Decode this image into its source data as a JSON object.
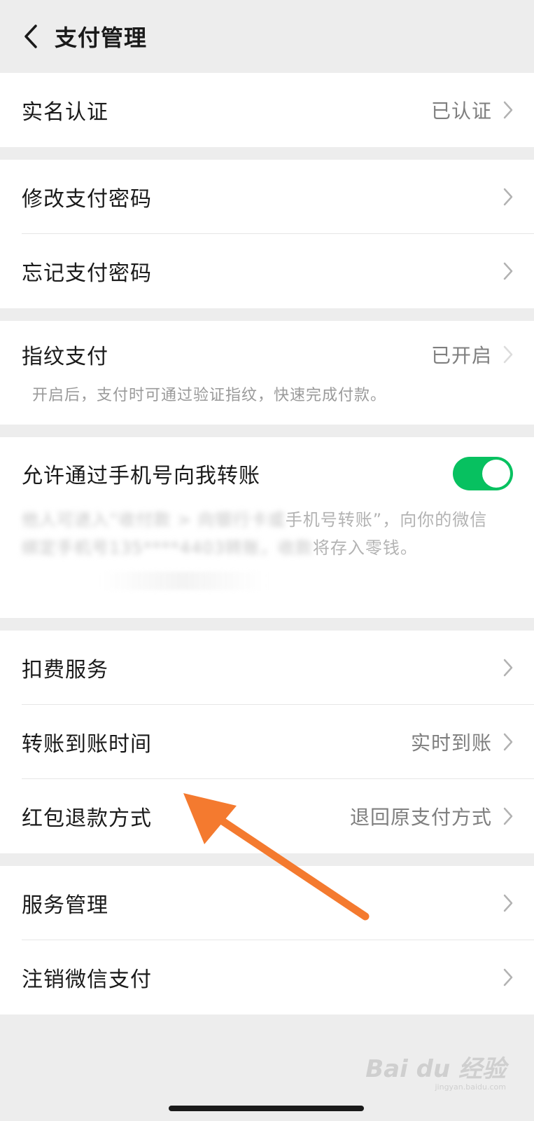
{
  "header": {
    "title": "支付管理",
    "back_icon": "chevron-left-icon"
  },
  "groups": {
    "verify": {
      "label": "实名认证",
      "value": "已认证"
    },
    "password": {
      "change_label": "修改支付密码",
      "forgot_label": "忘记支付密码"
    },
    "fingerprint": {
      "label": "指纹支付",
      "value": "已开启",
      "desc": "开启后，支付时可通过验证指纹，快速完成付款。"
    },
    "phone_transfer": {
      "label": "允许通过手机号向我转账",
      "toggle_on": true,
      "toggle_color": "#07c160",
      "desc_line1_blurred": "他人可进入“收付款 > 向银行卡或",
      "desc_line1_clear": "手机号转账”，向你的微信",
      "desc_line2_blurred": "绑定手机号135****4403转账，收款",
      "desc_line2_clear": "将存入零钱。"
    },
    "services": {
      "deduction_label": "扣费服务",
      "arrival_label": "转账到账时间",
      "arrival_value": "实时到账",
      "refund_label": "红包退款方式",
      "refund_value": "退回原支付方式"
    },
    "manage": {
      "service_label": "服务管理",
      "cancel_label": "注销微信支付"
    }
  },
  "annotation": {
    "arrow_color": "#f47a2f",
    "points_to": "红包退款方式"
  },
  "watermark": {
    "logo": "Bai du 经验",
    "url": "jingyan.baidu.com"
  }
}
